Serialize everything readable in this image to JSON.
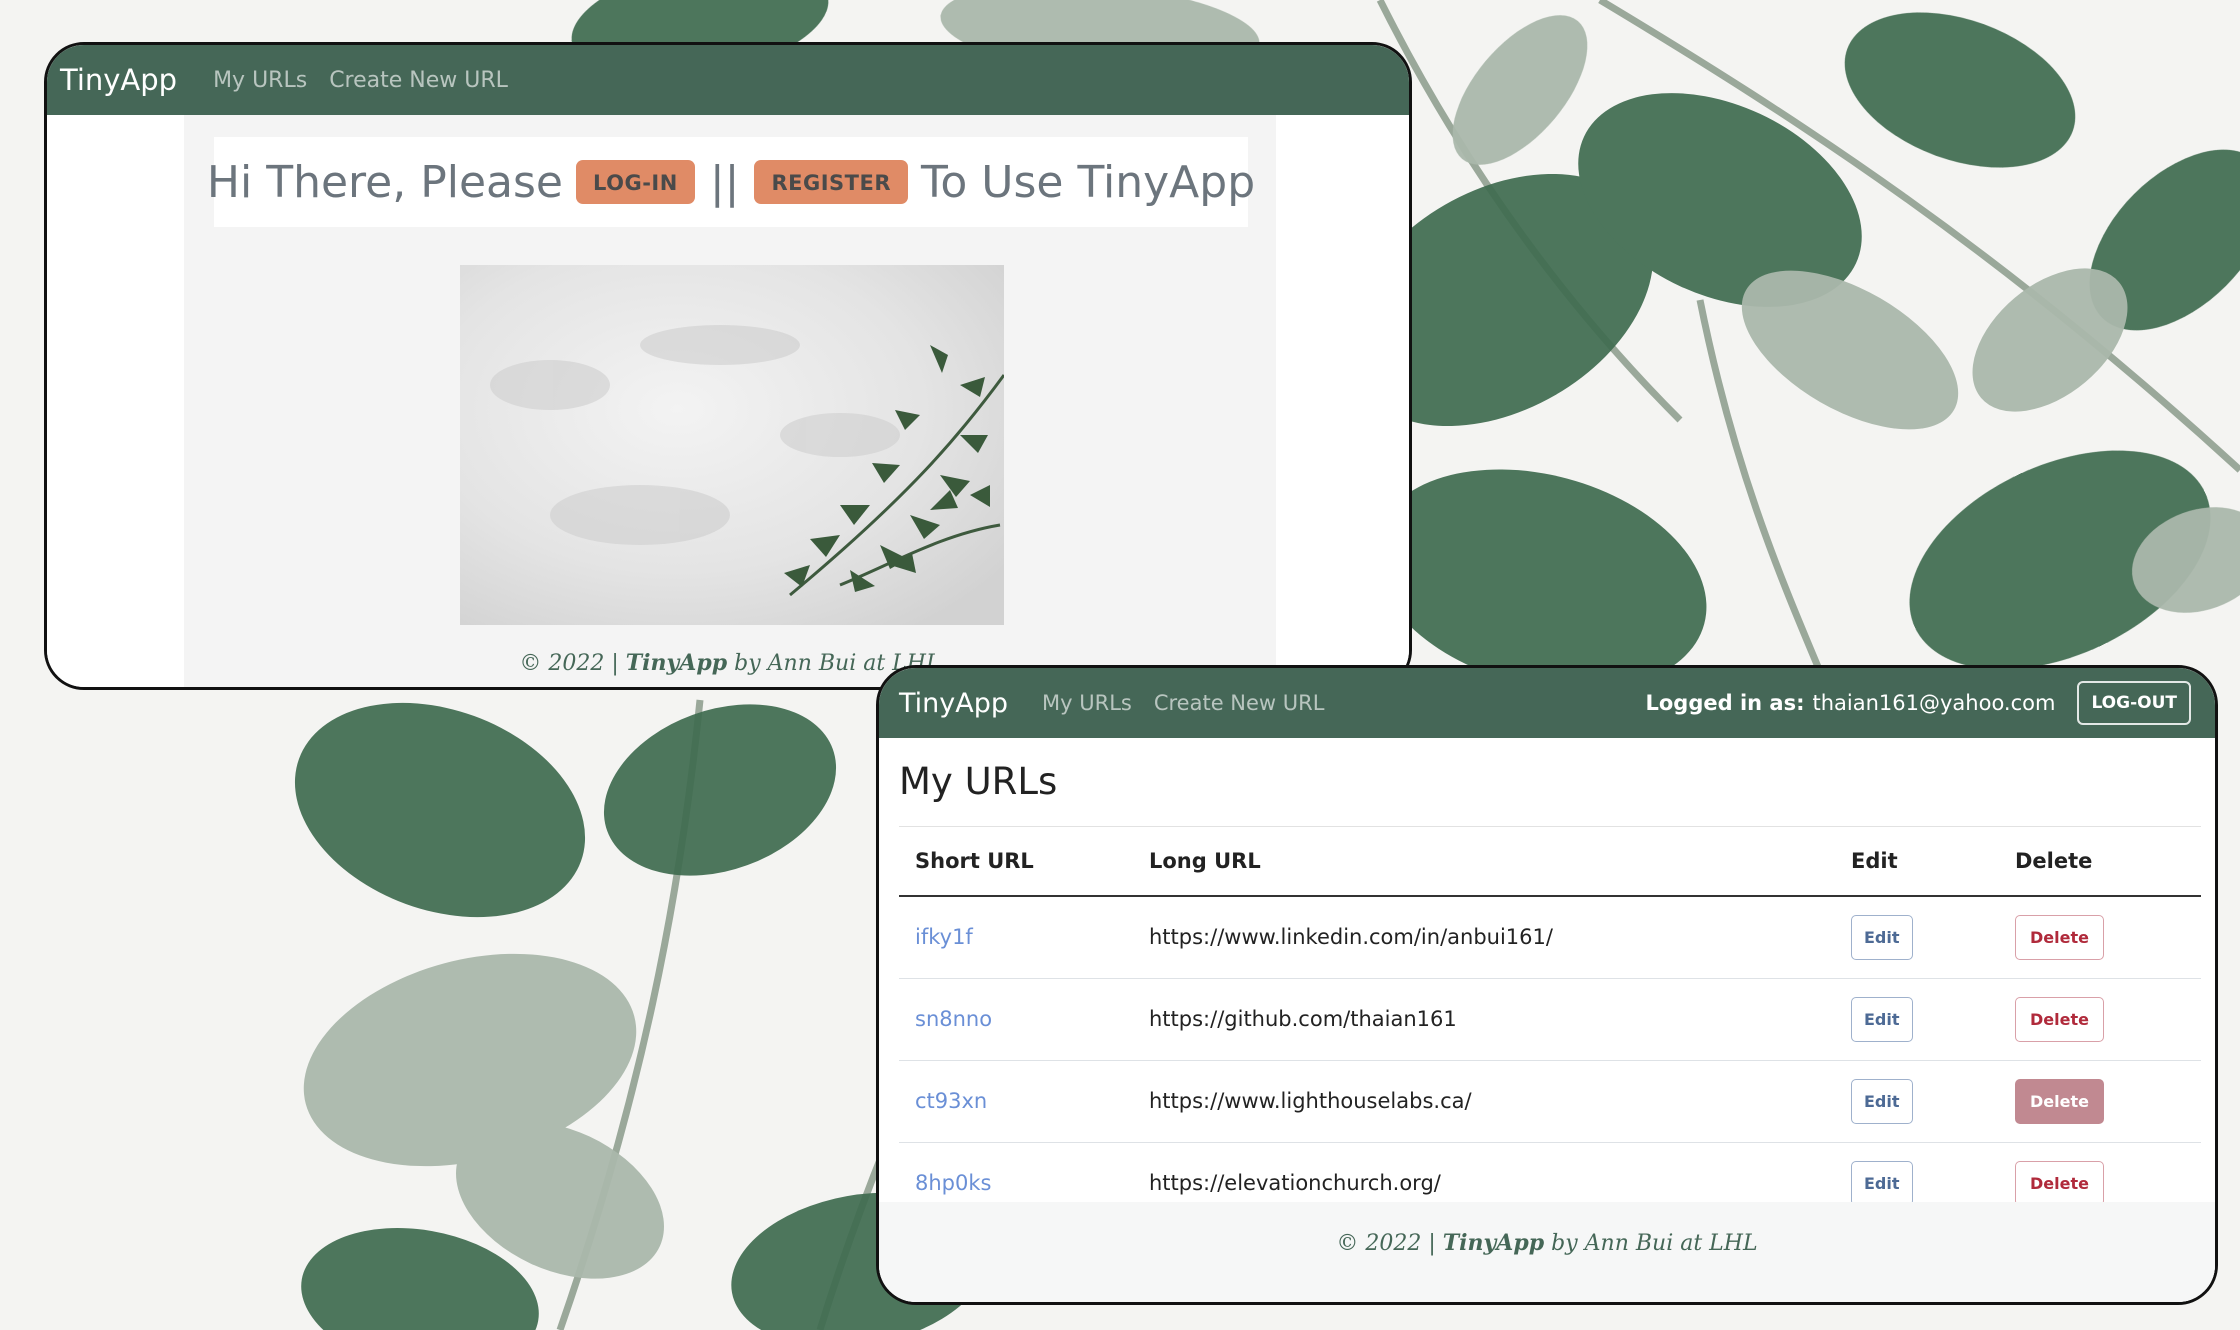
{
  "colors": {
    "navbar": "#456757",
    "accent_button": "#e08b66",
    "link": "#6a8fd6",
    "delete": "#b02a3b"
  },
  "window1": {
    "nav": {
      "brand": "TinyApp",
      "links": [
        "My URLs",
        "Create New URL"
      ]
    },
    "hero": {
      "prefix": "Hi There, Please",
      "login_label": "LOG-IN",
      "separator": "||",
      "register_label": "REGISTER",
      "suffix": "To Use TinyApp"
    },
    "footer": {
      "prefix": "© 2022 | ",
      "app": "TinyApp",
      "suffix": " by Ann Bui at LHL"
    }
  },
  "window2": {
    "nav": {
      "brand": "TinyApp",
      "links": [
        "My URLs",
        "Create New URL"
      ],
      "logged_in_label": "Logged in as:",
      "email": "thaian161@yahoo.com",
      "logout_label": "LOG-OUT"
    },
    "title": "My URLs",
    "table": {
      "headers": [
        "Short URL",
        "Long URL",
        "Edit",
        "Delete"
      ],
      "edit_label": "Edit",
      "delete_label": "Delete",
      "rows": [
        {
          "short": "ifky1f",
          "long": "https://www.linkedin.com/in/anbui161/"
        },
        {
          "short": "sn8nno",
          "long": "https://github.com/thaian161"
        },
        {
          "short": "ct93xn",
          "long": "https://www.lighthouselabs.ca/"
        },
        {
          "short": "8hp0ks",
          "long": "https://elevationchurch.org/"
        }
      ]
    },
    "footer": {
      "prefix": "© 2022 | ",
      "app": "TinyApp",
      "suffix": " by Ann Bui at LHL"
    }
  }
}
